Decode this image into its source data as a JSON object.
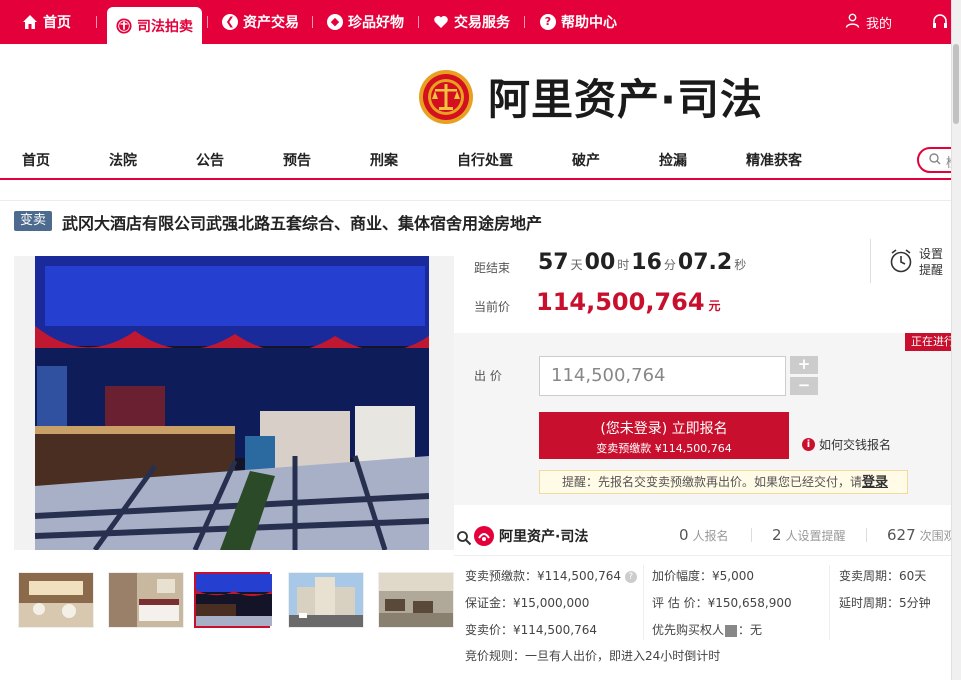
{
  "topnav": {
    "items": [
      {
        "label": "首页",
        "icon": "home-icon"
      },
      {
        "label": "司法拍卖",
        "icon": "court-emblem-icon"
      },
      {
        "label": "资产交易",
        "icon": "asset-icon"
      },
      {
        "label": "珍品好物",
        "icon": "gem-icon"
      },
      {
        "label": "交易服务",
        "icon": "heart-icon"
      },
      {
        "label": "帮助中心",
        "icon": "help-icon"
      }
    ],
    "my": "我的"
  },
  "brand": {
    "title": "阿里资产·司法"
  },
  "subnav": {
    "items": [
      "首页",
      "法院",
      "公告",
      "预告",
      "刑案",
      "自行处置",
      "破产",
      "捡漏",
      "精准获客"
    ],
    "search_placeholder": "检"
  },
  "item": {
    "badge": "变卖",
    "title": "武冈大酒店有限公司武强北路五套综合、商业、集体宿舍用途房地产"
  },
  "countdown": {
    "label": "距结束",
    "days": "57",
    "days_unit": "天",
    "hours": "00",
    "hours_unit": "时",
    "minutes": "16",
    "minutes_unit": "分",
    "seconds": "07.2",
    "seconds_unit": "秒"
  },
  "price": {
    "label": "当前价",
    "value": "114,500,764",
    "unit": "元"
  },
  "remind": {
    "line1": "设置",
    "line2": "提醒"
  },
  "status": {
    "ongoing": "正在进行"
  },
  "bid": {
    "label": "出 价",
    "value": "114,500,764",
    "plus": "+",
    "minus": "−",
    "button_line1": "(您未登录) 立即报名",
    "button_line2": "变卖预缴款 ¥114,500,764",
    "howto": "如何交钱报名",
    "tip_text": "提醒：先报名交变卖预缴款再出价。如果您已经交付，请",
    "tip_link": "登录"
  },
  "stats": {
    "logo_text": "阿里资产·司法",
    "signups": "0",
    "signups_label": "人报名",
    "reminders": "2",
    "reminders_label": "人设置提醒",
    "views": "627",
    "views_label": "次围观"
  },
  "details": {
    "deposit_pay": "变卖预缴款：¥114,500,764",
    "increment": "加价幅度：¥5,000",
    "period": "变卖周期：60天",
    "margin": "保证金：¥15,000,000",
    "appraisal": "评 估 价：¥150,658,900",
    "delay": "延时周期：5分钟",
    "sale_price": "变卖价：¥114,500,764",
    "priority_label": "优先购买权人",
    "priority_value": "：无",
    "rule": "竞价规则：一旦有人出价，即进入24小时倒计时"
  },
  "colors": {
    "brand": "#e4003a",
    "price": "#c8102e",
    "badge": "#4d6b8e"
  }
}
